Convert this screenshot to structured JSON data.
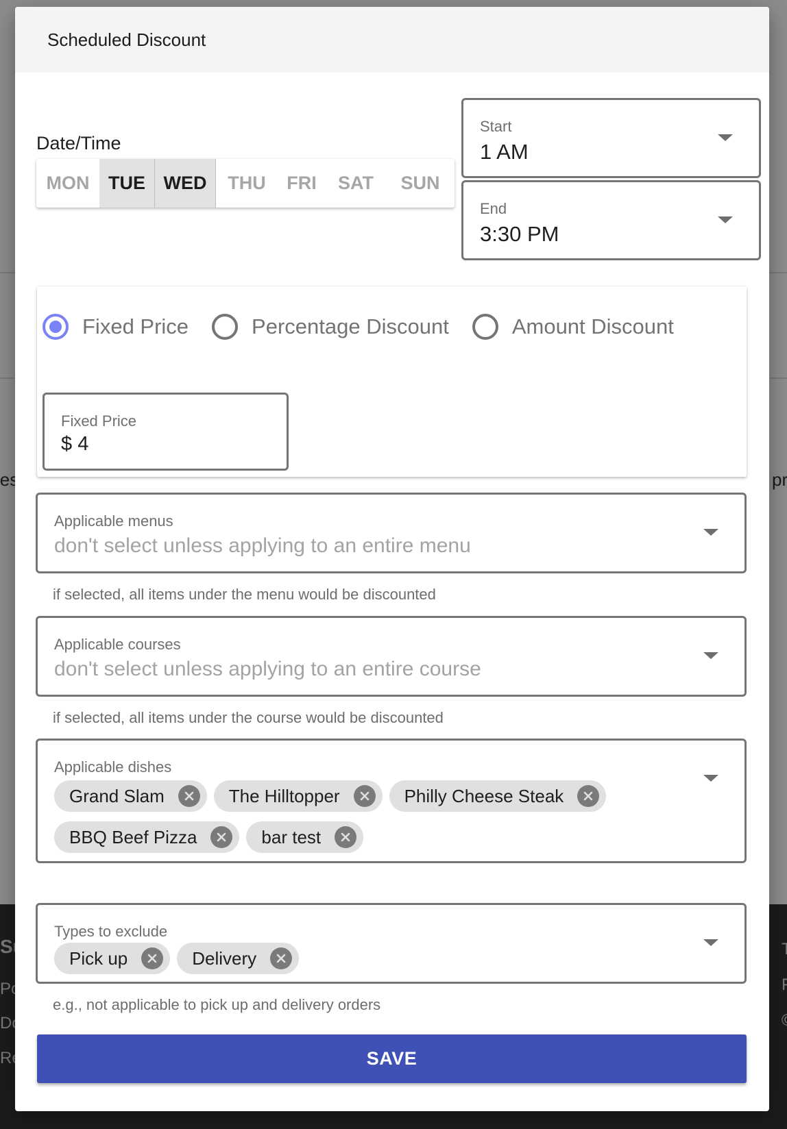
{
  "background": {
    "left_fragment_mid": "ies",
    "right_fragment_mid": "pr",
    "footer_left": [
      "Su",
      "Po",
      "Do",
      "Re"
    ],
    "footer_right": [
      "T",
      "F",
      "©"
    ]
  },
  "modal": {
    "title": "Scheduled Discount",
    "date_time_label": "Date/Time",
    "days": [
      {
        "label": "MON",
        "selected": false
      },
      {
        "label": "TUE",
        "selected": true
      },
      {
        "label": "WED",
        "selected": true
      },
      {
        "label": "THU",
        "selected": false
      },
      {
        "label": "FRI",
        "selected": false
      },
      {
        "label": "SAT",
        "selected": false
      },
      {
        "label": "SUN",
        "selected": false
      }
    ],
    "start": {
      "label": "Start",
      "value": "1 AM"
    },
    "end": {
      "label": "End",
      "value": "3:30 PM"
    },
    "discount_type": {
      "options": [
        {
          "label": "Fixed Price",
          "selected": true
        },
        {
          "label": "Percentage Discount",
          "selected": false
        },
        {
          "label": "Amount Discount",
          "selected": false
        }
      ],
      "accent_color": "#7b82f6"
    },
    "fixed_price": {
      "label": "Fixed Price",
      "prefix": "$",
      "value": "4"
    },
    "applicable_menus": {
      "label": "Applicable menus",
      "placeholder": "don't select unless applying to an entire menu",
      "helper": "if selected, all items under the menu would be discounted"
    },
    "applicable_courses": {
      "label": "Applicable courses",
      "placeholder": "don't select unless applying to an entire course",
      "helper": "if selected, all items under the course would be discounted"
    },
    "applicable_dishes": {
      "label": "Applicable dishes",
      "chips": [
        "Grand Slam",
        "The Hilltopper",
        "Philly Cheese Steak",
        "BBQ Beef Pizza",
        "bar test"
      ]
    },
    "types_to_exclude": {
      "label": "Types to exclude",
      "chips": [
        "Pick up",
        "Delivery"
      ],
      "helper": "e.g., not applicable to pick up and delivery orders"
    },
    "save_label": "SAVE",
    "save_color": "#3f51b5"
  }
}
